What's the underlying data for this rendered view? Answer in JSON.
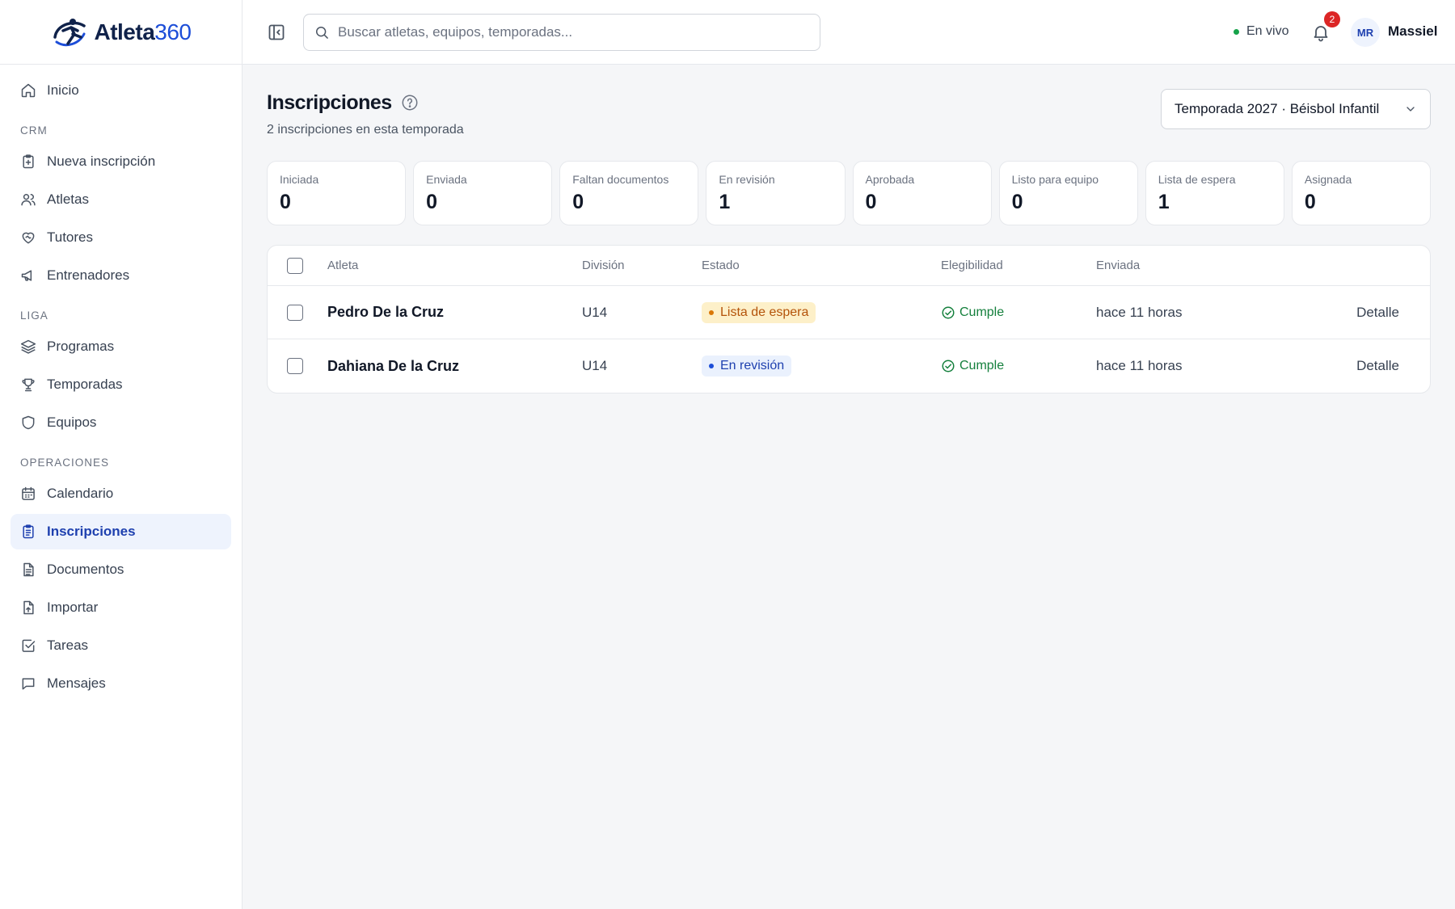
{
  "app": {
    "name": "Atleta",
    "name_num": "360"
  },
  "sidebar": {
    "top": [
      {
        "label": "Inicio",
        "icon": "home-icon"
      }
    ],
    "sections": [
      {
        "title": "CRM",
        "items": [
          {
            "label": "Nueva inscripción",
            "icon": "clipboard-plus-icon"
          },
          {
            "label": "Atletas",
            "icon": "users-icon"
          },
          {
            "label": "Tutores",
            "icon": "heart-handshake-icon"
          },
          {
            "label": "Entrenadores",
            "icon": "megaphone-icon"
          }
        ]
      },
      {
        "title": "LIGA",
        "items": [
          {
            "label": "Programas",
            "icon": "layers-icon"
          },
          {
            "label": "Temporadas",
            "icon": "trophy-icon"
          },
          {
            "label": "Equipos",
            "icon": "shield-icon"
          }
        ]
      },
      {
        "title": "OPERACIONES",
        "items": [
          {
            "label": "Calendario",
            "icon": "calendar-icon"
          },
          {
            "label": "Inscripciones",
            "icon": "clipboard-list-icon",
            "active": true
          },
          {
            "label": "Documentos",
            "icon": "file-text-icon"
          },
          {
            "label": "Importar",
            "icon": "file-upload-icon"
          },
          {
            "label": "Tareas",
            "icon": "check-square-icon"
          },
          {
            "label": "Mensajes",
            "icon": "message-icon"
          }
        ]
      }
    ]
  },
  "topbar": {
    "search_placeholder": "Buscar atletas, equipos, temporadas...",
    "live_label": "En vivo",
    "notifications_count": "2",
    "user_initials": "MR",
    "user_name": "Massiel"
  },
  "main": {
    "title": "Inscripciones",
    "subtitle": "2 inscripciones en esta temporada",
    "season_selected": "Temporada 2027 · Béisbol Infantil"
  },
  "stats": [
    {
      "label": "Iniciada",
      "value": "0"
    },
    {
      "label": "Enviada",
      "value": "0"
    },
    {
      "label": "Faltan documentos",
      "value": "0"
    },
    {
      "label": "En revisión",
      "value": "1"
    },
    {
      "label": "Aprobada",
      "value": "0"
    },
    {
      "label": "Listo para equipo",
      "value": "0"
    },
    {
      "label": "Lista de espera",
      "value": "1"
    },
    {
      "label": "Asignada",
      "value": "0"
    }
  ],
  "table": {
    "headers": {
      "athlete": "Atleta",
      "division": "División",
      "status": "Estado",
      "eligibility": "Elegibilidad",
      "sent": "Enviada"
    },
    "rows": [
      {
        "athlete": "Pedro De la Cruz",
        "division": "U14",
        "status": "Lista de espera",
        "status_kind": "wait",
        "eligibility": "Cumple",
        "sent": "hace 11 horas",
        "action": "Detalle"
      },
      {
        "athlete": "Dahiana De la Cruz",
        "division": "U14",
        "status": "En revisión",
        "status_kind": "rev",
        "eligibility": "Cumple",
        "sent": "hace 11 horas",
        "action": "Detalle"
      }
    ]
  },
  "colors": {
    "accent": "#1e40af",
    "live": "#16a34a",
    "badge": "#dc2626",
    "ok": "#15803d",
    "wait": "#b45309"
  }
}
